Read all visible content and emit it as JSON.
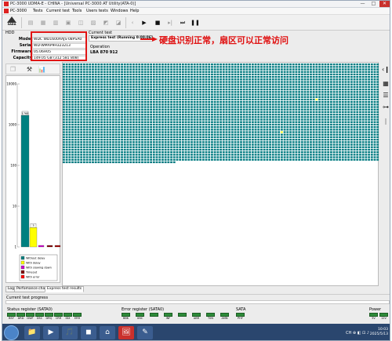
{
  "window": {
    "title": "PC-3000 UDMA-E - CHINA - [Universal PC-3000 AT Utility(ATA-0)]",
    "controls": [
      "—",
      "□",
      "✕"
    ]
  },
  "menu": [
    "PC-3000",
    "Tests",
    "Current test",
    "Tools",
    "Users tests",
    "Windows",
    "Help"
  ],
  "toolbar": {
    "logo_text": "SADA"
  },
  "hdd": {
    "label": "HDD",
    "fields": [
      {
        "key": "Model",
        "value": "WDC WD1600AAJS-08PSA0"
      },
      {
        "key": "Serial",
        "value": "WD-WMAP9H323213"
      },
      {
        "key": "Firmware",
        "value": "05.06H05"
      },
      {
        "key": "Capacity",
        "value": "149.05 GB (312 581 808)"
      }
    ]
  },
  "current_test": {
    "label": "Current test",
    "name": "Express test (Running 0:00:06)",
    "operation_label": "Operation",
    "lba_label": "LBA",
    "lba_value": "870 912"
  },
  "annotation": {
    "text": "硬盘识别正常，扇区可以正常访问",
    "color": "#e01010"
  },
  "chart_data": {
    "type": "bar",
    "scale": "log",
    "yticks": [
      "10000",
      "1000",
      "100",
      "10",
      "1"
    ],
    "values": [
      1700,
      3,
      0.5,
      0.5,
      0.5
    ],
    "bar_labels": [
      "1768",
      "3",
      "",
      "",
      ""
    ],
    "colors": [
      "#008080",
      "#ffff00",
      "#cc00cc",
      "#800000",
      "#a00000"
    ],
    "legend": [
      {
        "label": "Without delay",
        "color": "#008080"
      },
      {
        "label": "With delay",
        "color": "#ffff00"
      },
      {
        "label": "With slowing down",
        "color": "#cc00cc"
      },
      {
        "label": "Timeout",
        "color": "#800000"
      },
      {
        "label": "With error",
        "color": "#ff0000"
      }
    ]
  },
  "sector_map": {
    "cols": 109,
    "full_rows": 39,
    "partial_row_cells": 39,
    "ok_color": "#007a80",
    "delay_color": "#ffff33",
    "delay_cells": [
      [
        14,
        87
      ],
      [
        27,
        75
      ]
    ]
  },
  "tabs": [
    {
      "label": "Log",
      "active": false
    },
    {
      "label": "Perfomance chart",
      "active": false
    },
    {
      "label": "Express test results",
      "active": true
    }
  ],
  "progress": {
    "label": "Current test progress"
  },
  "status_register": {
    "label": "Status register (SATA0)",
    "leds": [
      "BSY",
      "DRD",
      "DWF",
      "DSC",
      "DRQ",
      "CRR",
      "IDX",
      "ERR"
    ]
  },
  "error_register": {
    "label": "Error register (SATA0)",
    "leds": [
      "BBK",
      "UNC",
      "",
      "INF",
      "",
      "ABR",
      "T0N",
      "AMN"
    ]
  },
  "sata": {
    "label": "SATA",
    "leds": [
      "PHY"
    ]
  },
  "power": {
    "label": "Power",
    "leds": [
      "5V",
      "12V"
    ]
  },
  "taskbar": {
    "apps": [
      "📁",
      "▶",
      "🎵",
      "◼",
      "⌂",
      "🖼",
      "✎"
    ],
    "tray": "CH ⊕ ◧ ⊡ ♪",
    "time": "10:03",
    "date": "2025/5/13"
  }
}
